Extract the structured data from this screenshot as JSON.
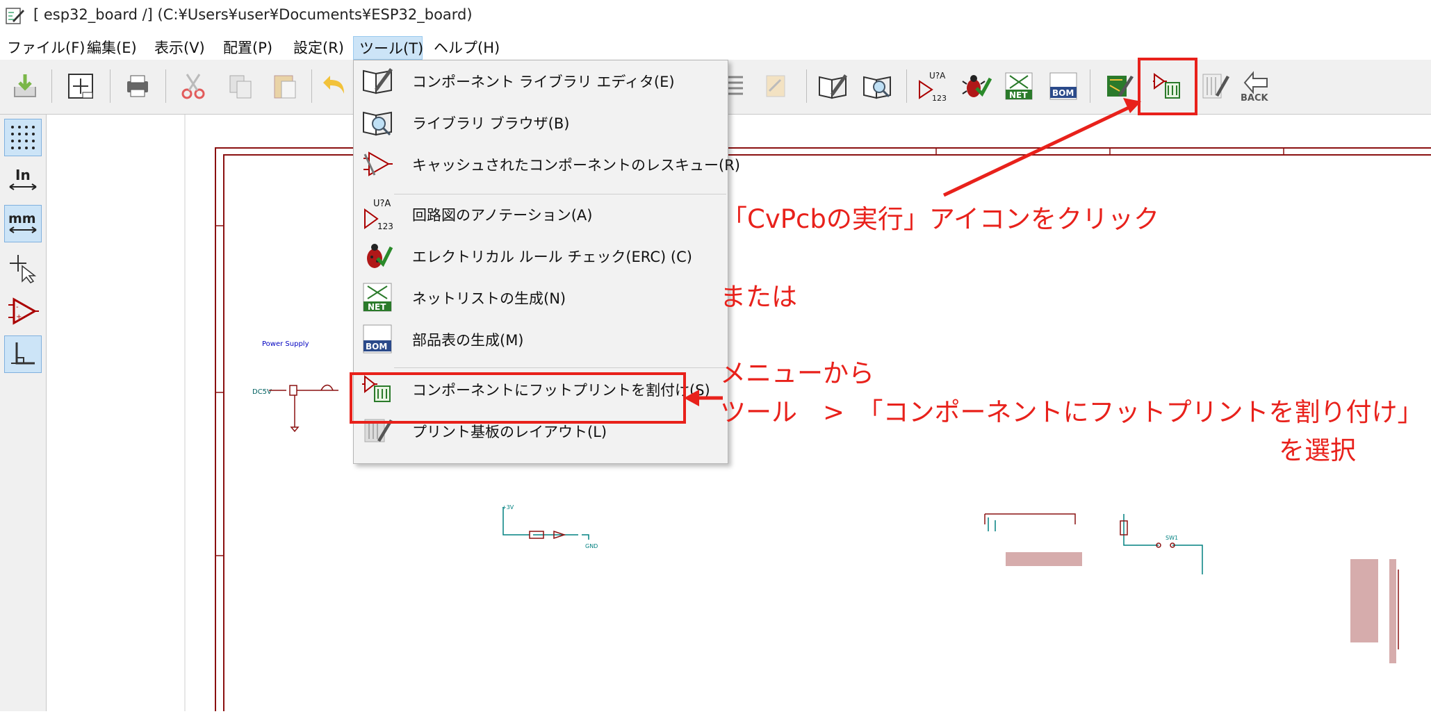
{
  "window": {
    "title": "[ esp32_board /] (C:¥Users¥user¥Documents¥ESP32_board)"
  },
  "menubar": {
    "items": [
      {
        "label": "ファイル(F)"
      },
      {
        "label": "編集(E)"
      },
      {
        "label": "表示(V)"
      },
      {
        "label": "配置(P)"
      },
      {
        "label": "設定(R)"
      },
      {
        "label": "ツール(T)"
      },
      {
        "label": "ヘルプ(H)"
      }
    ]
  },
  "toolbar": {
    "annotate_top": "U?A",
    "annotate_bottom": "123",
    "net_label": "NET",
    "bom_label": "BOM",
    "back_label": "BACK"
  },
  "left_tools": {
    "inch_label": "In",
    "mm_label": "mm"
  },
  "tools_menu": {
    "items": [
      {
        "label": "コンポーネント ライブラリ エディタ(E)"
      },
      {
        "label": "ライブラリ ブラウザ(B)"
      },
      {
        "label": "キャッシュされたコンポーネントのレスキュー(R)"
      },
      {
        "label": "回路図のアノテーション(A)"
      },
      {
        "label": "エレクトリカル ルール チェック(ERC) (C)"
      },
      {
        "label": "ネットリストの生成(N)"
      },
      {
        "label": "部品表の生成(M)"
      },
      {
        "label": "コンポーネントにフットプリントを割付け(S)"
      },
      {
        "label": "プリント基板のレイアウト(L)"
      }
    ]
  },
  "annotations": {
    "cvpcb_hint": "「CvPcbの実行」アイコンをクリック",
    "or": "または",
    "from_menu": "メニューから",
    "menu_path": "ツール　>　「コンポーネントにフットプリントを割り付け」",
    "select": "を選択",
    "color": "#e8211b"
  },
  "schematic": {
    "power_label": "Power Supply",
    "dc_label": "DC5V",
    "gnd_label": "GND",
    "v33_label": "+3V",
    "sw_label": "SW1"
  }
}
